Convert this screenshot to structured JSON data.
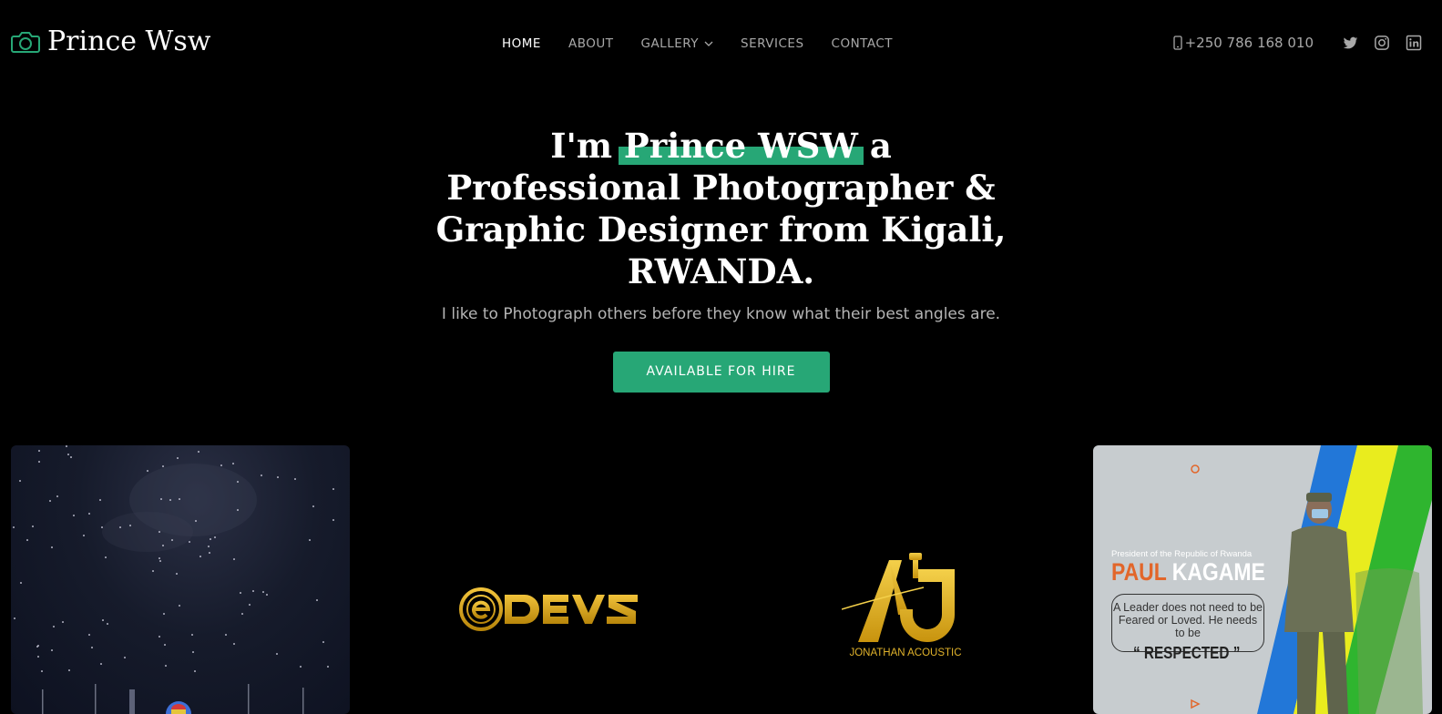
{
  "brand": {
    "name": "Prince Wsw",
    "accent": "#27a776"
  },
  "nav": {
    "items": [
      {
        "label": "HOME",
        "active": true
      },
      {
        "label": "ABOUT"
      },
      {
        "label": "GALLERY"
      },
      {
        "label": "SERVICES"
      },
      {
        "label": "CONTACT"
      }
    ]
  },
  "contact": {
    "phone": "+250 786 168 010"
  },
  "social": [
    "twitter-icon",
    "instagram-icon",
    "linkedin-icon"
  ],
  "hero": {
    "title_pre": "I'm ",
    "title_highlight": "Prince WSW",
    "title_post": " a Professional Photographer & Graphic Designer from Kigali, RWANDA.",
    "subtitle": "I like to Photograph others before they know what their best angles are.",
    "cta": "AVAILABLE FOR HIRE"
  },
  "gallery": {
    "aj_label": "JONATHAN ACOUSTIC",
    "poster": {
      "small": "President of the Republic of Rwanda",
      "name_first": "PAUL",
      "name_last": "KAGAME",
      "quote": "A Leader does not need to be  Feared or Loved. He needs to be",
      "emphasis": "RESPECTED"
    }
  }
}
